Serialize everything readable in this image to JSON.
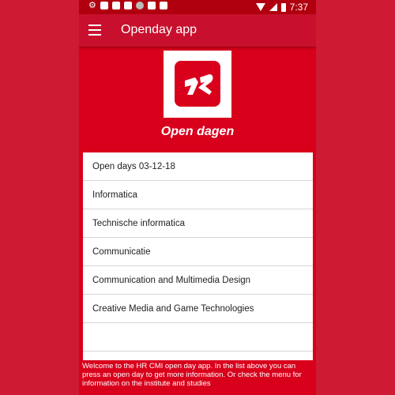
{
  "status_bar": {
    "time": "7:37",
    "icons": [
      "gear-icon",
      "shield-check-icon",
      "shield-icon",
      "mail-icon",
      "circle-icon",
      "sd-card-icon",
      "shield-outline-icon"
    ],
    "right_icons": [
      "wifi-icon",
      "signal-icon",
      "battery-icon"
    ]
  },
  "app_bar": {
    "menu_icon": "hamburger-menu-icon",
    "title": "Openday app"
  },
  "logo": {
    "icon": "hr-logo-icon",
    "color": "#d9001c"
  },
  "section": {
    "title": "Open dagen"
  },
  "list": {
    "items": [
      {
        "label": "Open days 03-12-18"
      },
      {
        "label": "Informatica"
      },
      {
        "label": "Technische informatica"
      },
      {
        "label": "Communicatie"
      },
      {
        "label": "Communication and Multimedia Design"
      },
      {
        "label": "Creative Media and Game Technologies"
      },
      {
        "label": ""
      }
    ]
  },
  "footer": {
    "text": "Welcome to the HR CMI open day app. In the list above you can press an open day to get more information. Or check the menu for information on the institute and studies"
  },
  "colors": {
    "background": "#ce1a33",
    "app_bar": "#c8102e",
    "screen": "#d9001c",
    "status_bar": "#b0000f"
  }
}
